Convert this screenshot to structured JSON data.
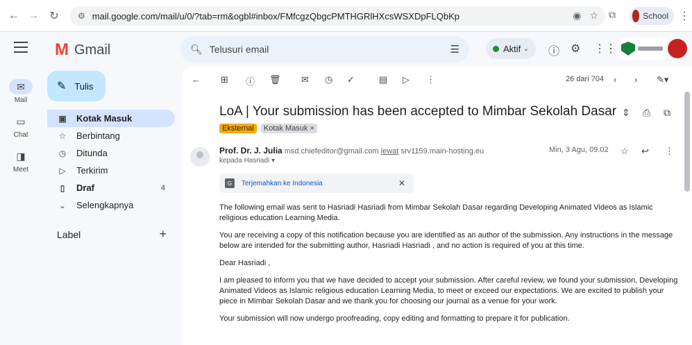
{
  "browser": {
    "url": "mail.google.com/mail/u/0/?tab=rm&ogbl#inbox/FMfcgzQbgcPMTHGRlHXcsWSXDpFLQbKp",
    "profile_label": "School"
  },
  "header": {
    "app_name": "Gmail",
    "search_placeholder": "Telusuri email",
    "status_label": "Aktif"
  },
  "rail": [
    {
      "label": "Mail"
    },
    {
      "label": "Chat"
    },
    {
      "label": "Meet"
    }
  ],
  "compose_label": "Tulis",
  "nav": {
    "items": [
      {
        "label": "Kotak Masuk",
        "icon": "inbox-icon"
      },
      {
        "label": "Berbintang",
        "icon": "star-icon"
      },
      {
        "label": "Ditunda",
        "icon": "clock-icon"
      },
      {
        "label": "Terkirim",
        "icon": "send-icon"
      },
      {
        "label": "Draf",
        "icon": "draft-icon",
        "count": "4"
      },
      {
        "label": "Selengkapnya",
        "icon": "chevron-down-icon"
      }
    ],
    "labels_title": "Label"
  },
  "message": {
    "counter": "26 dari 704",
    "subject": "LoA | Your submission has been accepted to Mimbar Sekolah Dasar",
    "labels": [
      "Eksternal",
      "Kotak Masuk ×"
    ],
    "sender_name": "Prof. Dr. J. Julia",
    "sender_email": "msd.chiefeditor@gmail.com",
    "via_word": "lewat",
    "via_host": "srv1159.main-hosting.eu",
    "to_line": "kepada Hasriadi ▾",
    "date": "Min, 3 Agu, 09.02",
    "translate_label": "Terjemahkan ke Indonesia",
    "paragraphs": [
      "The following email was sent to  Hasriadi Hasriadi  from Mimbar Sekolah Dasar regarding Developing Animated Videos as Islamic religious education Learning Media.",
      "You are receiving a copy of this notification because you are identified as an author of the submission. Any instructions in the message below are intended for the submitting author,  Hasriadi Hasriadi , and no action is required of you at this time.",
      "Dear  Hasriadi ,",
      "I am pleased to inform you that we have decided to accept your submission. After careful review, we found your submission, Developing Animated Videos as Islamic religious education Learning Media, to meet or exceed our expectations. We are excited to publish your piece in Mimbar Sekolah Dasar and we thank you for choosing our journal as a venue for your work.",
      "Your submission will now undergo proofreading, copy editing and formatting to prepare it for publication."
    ]
  },
  "colors": {
    "compose_bg": "#c2e7ff",
    "nav_active_bg": "#d3e3fd",
    "external_label": "#f9ab00",
    "status_green": "#1e8e3e"
  }
}
